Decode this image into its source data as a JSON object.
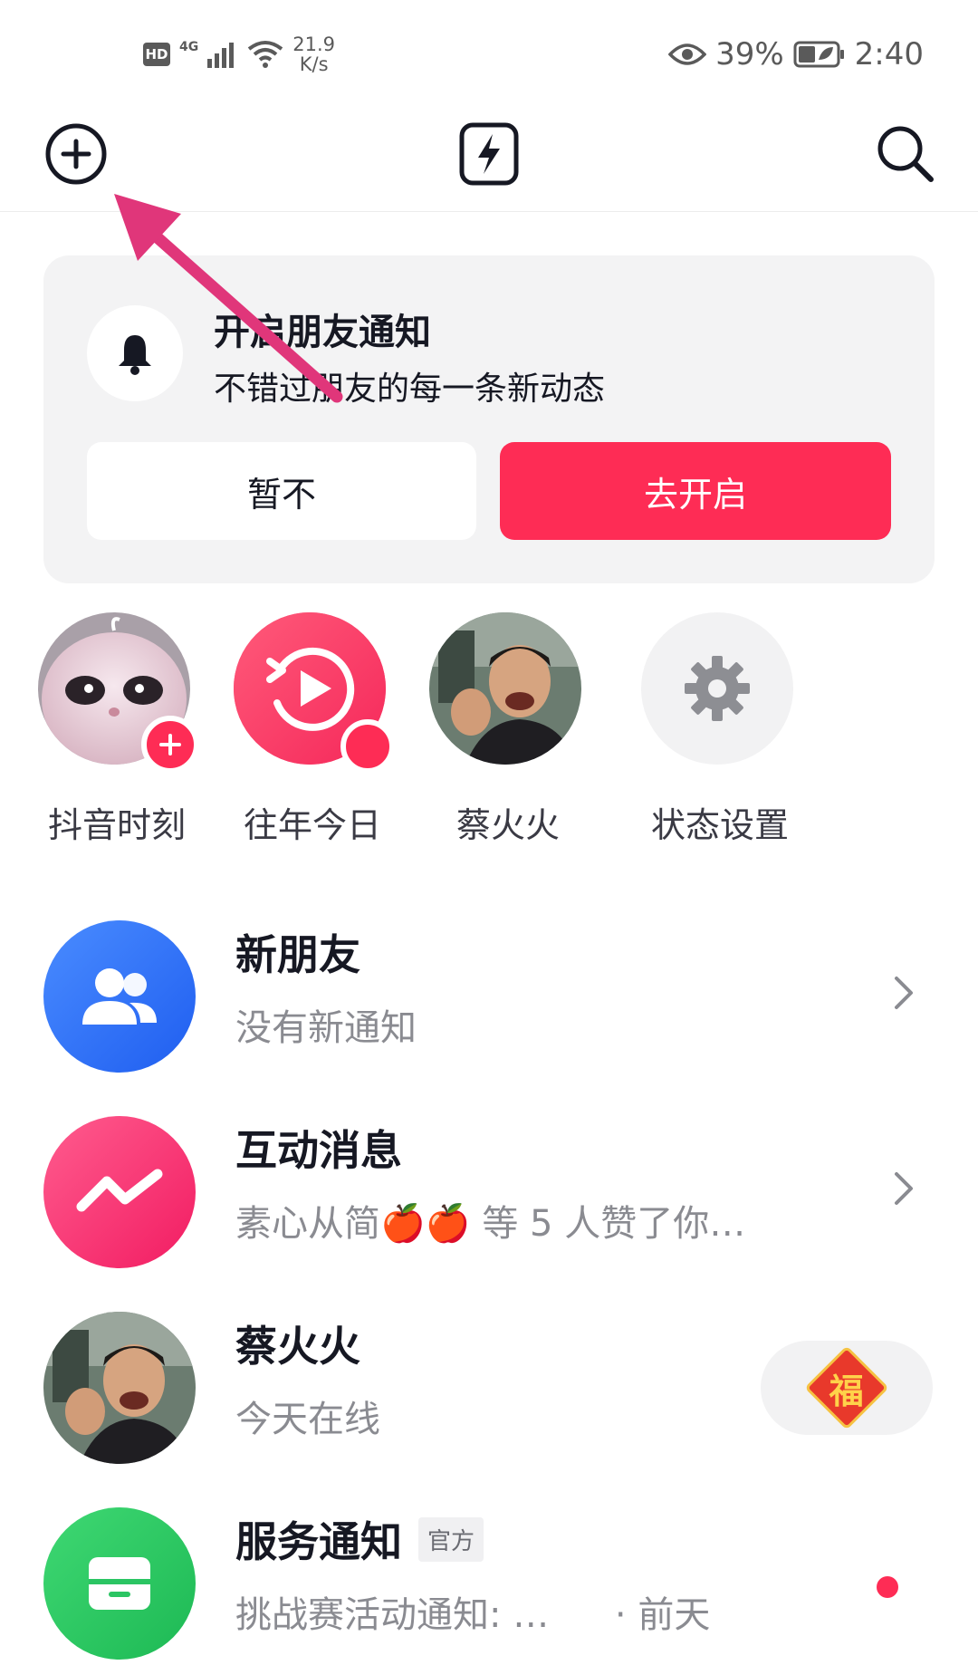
{
  "status_bar": {
    "hd": "HD",
    "network": "4G",
    "speed_value": "21.9",
    "speed_unit": "K/s",
    "battery": "39%",
    "time": "2:40"
  },
  "header": {
    "add_icon": "plus-circle-icon",
    "center_icon": "lightning-icon",
    "search_icon": "search-icon"
  },
  "notification_card": {
    "title": "开启朋友通知",
    "subtitle": "不错过朋友的每一条新动态",
    "later_label": "暂不",
    "enable_label": "去开启"
  },
  "stories": [
    {
      "label": "抖音时刻"
    },
    {
      "label": "往年今日"
    },
    {
      "label": "蔡火火"
    },
    {
      "label": "状态设置"
    }
  ],
  "messages": [
    {
      "title": "新朋友",
      "subtitle": "没有新通知"
    },
    {
      "title": "互动消息",
      "subtitle": "素心从简🍎🍎 等 5 人赞了你…"
    },
    {
      "title": "蔡火火",
      "subtitle": "今天在线",
      "badge": "福"
    },
    {
      "title": "服务通知",
      "tag": "官方",
      "subtitle": "挑战赛活动通知: …",
      "time": "· 前天"
    }
  ],
  "colors": {
    "accent": "#fe2c55",
    "new_friends_blue": "#2f6bf5",
    "interaction_pink": "#ff3d7f",
    "service_green": "#25c15b",
    "annotation_arrow": "#e0367a"
  }
}
